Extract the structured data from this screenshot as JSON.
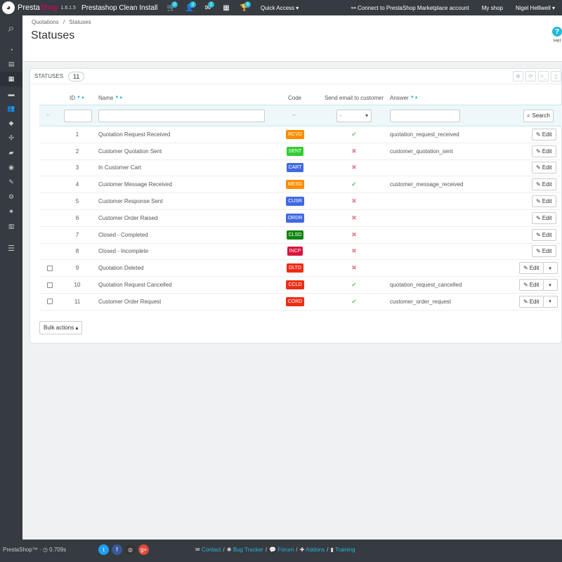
{
  "topbar": {
    "logo_presta": "Presta",
    "logo_shop": "Shop",
    "version": "1.6.1.5",
    "shop_name": "Prestashop Clean Install",
    "notifications": [
      {
        "icon": "cart-icon",
        "glyph": "🛒",
        "count": "0"
      },
      {
        "icon": "user-icon",
        "glyph": "👤",
        "count": "2"
      },
      {
        "icon": "envelope-icon",
        "glyph": "✉",
        "count": "2"
      },
      {
        "icon": "calculator-icon",
        "glyph": "▦",
        "count": ""
      },
      {
        "icon": "trophy-icon",
        "glyph": "🏆",
        "count": "8"
      }
    ],
    "quick_access": "Quick Access ▾",
    "marketplace": "Connect to PrestaShop Marketplace account",
    "my_shop": "My shop",
    "user": "Nigel Helliwell ▾"
  },
  "sidebar": {
    "items": [
      {
        "name": "dashboard-icon",
        "glyph": "◔"
      },
      {
        "name": "catalog-icon",
        "glyph": "▤"
      },
      {
        "name": "quotations-icon",
        "glyph": "▦"
      },
      {
        "name": "payment-icon",
        "glyph": "▬"
      },
      {
        "name": "customers-icon",
        "glyph": "👥"
      },
      {
        "name": "price-rules-icon",
        "glyph": "◆"
      },
      {
        "name": "modules-icon",
        "glyph": "✣"
      },
      {
        "name": "shipping-icon",
        "glyph": "▰"
      },
      {
        "name": "localization-icon",
        "glyph": "◉"
      },
      {
        "name": "preferences-icon",
        "glyph": "✎"
      },
      {
        "name": "advanced-parameters-icon",
        "glyph": "⚙"
      },
      {
        "name": "administration-icon",
        "glyph": "✷"
      },
      {
        "name": "stats-icon",
        "glyph": "▥"
      }
    ]
  },
  "breadcrumb": {
    "parent": "Quotations",
    "separator": "/",
    "current": "Statuses"
  },
  "page": {
    "title": "Statuses",
    "help": "Hel"
  },
  "panel": {
    "title": "Statuses",
    "count": "11",
    "bulk_actions": "Bulk actions ▴"
  },
  "columns": {
    "id": "ID",
    "name": "Name",
    "code": "Code",
    "send_email": "Send email to customer",
    "answer": "Answer",
    "sort_glyph": "▼▲"
  },
  "filters": {
    "code_placeholder": "--",
    "email_select": "-",
    "search_label": "Search",
    "reset_glyph": "--"
  },
  "rows": [
    {
      "id": "1",
      "name": "Quotation Request Received",
      "code": "RCVD",
      "color": "#ff8c00",
      "email": true,
      "answer": "quotation_request_received",
      "checkbox": false,
      "dropdown": false
    },
    {
      "id": "2",
      "name": "Customer Quotation Sent",
      "code": "SENT",
      "color": "#32cd32",
      "email": false,
      "answer": "customer_quotation_sent",
      "checkbox": false,
      "dropdown": false
    },
    {
      "id": "3",
      "name": "In Customer Cart",
      "code": "CART",
      "color": "#4169e1",
      "email": false,
      "answer": "",
      "checkbox": false,
      "dropdown": false
    },
    {
      "id": "4",
      "name": "Customer Message Received",
      "code": "MESG",
      "color": "#ff8c00",
      "email": true,
      "answer": "customer_message_received",
      "checkbox": false,
      "dropdown": false
    },
    {
      "id": "5",
      "name": "Customer Response Sent",
      "code": "CUSR",
      "color": "#4169e1",
      "email": false,
      "answer": "",
      "checkbox": false,
      "dropdown": false
    },
    {
      "id": "6",
      "name": "Customer Order Raised",
      "code": "ORDR",
      "color": "#4169e1",
      "email": false,
      "answer": "",
      "checkbox": false,
      "dropdown": false
    },
    {
      "id": "7",
      "name": "Closed - Completed",
      "code": "CLSD",
      "color": "#108510",
      "email": false,
      "answer": "",
      "checkbox": false,
      "dropdown": false
    },
    {
      "id": "8",
      "name": "Closed - Incomplete",
      "code": "INCP",
      "color": "#dc143c",
      "email": false,
      "answer": "",
      "checkbox": false,
      "dropdown": false
    },
    {
      "id": "9",
      "name": "Quotation Deleted",
      "code": "DLTD",
      "color": "#ec2e15",
      "email": false,
      "answer": "",
      "checkbox": true,
      "dropdown": true
    },
    {
      "id": "10",
      "name": "Quotation Request Cancelled",
      "code": "CCLD",
      "color": "#ec2e15",
      "email": true,
      "answer": "quotation_request_cancelled",
      "checkbox": true,
      "dropdown": true
    },
    {
      "id": "11",
      "name": "Customer Order Request",
      "code": "CORD",
      "color": "#ec2e15",
      "email": true,
      "answer": "customer_order_request",
      "checkbox": true,
      "dropdown": true
    }
  ],
  "row_labels": {
    "edit": "Edit",
    "check": "✔",
    "cross": "✖",
    "caret": "▾"
  },
  "footer": {
    "brand": "PrestaShop™",
    "separator": "·",
    "time": "0.709s",
    "links": [
      {
        "icon": "envelope-icon",
        "glyph": "✉",
        "label": "Contact"
      },
      {
        "icon": "bug-icon",
        "glyph": "✱",
        "label": "Bug Tracker"
      },
      {
        "icon": "forum-icon",
        "glyph": "💬",
        "label": "Forum"
      },
      {
        "icon": "puzzle-icon",
        "glyph": "✚",
        "label": "Addons"
      },
      {
        "icon": "book-icon",
        "glyph": "▮",
        "label": "Training"
      }
    ],
    "link_separator": "/",
    "social": [
      {
        "name": "twitter-icon",
        "glyph": "t",
        "color": "#1da1f2"
      },
      {
        "name": "facebook-icon",
        "glyph": "f",
        "color": "#3b5998"
      },
      {
        "name": "github-icon",
        "glyph": "◎",
        "color": "#333333"
      },
      {
        "name": "google-plus-icon",
        "glyph": "g+",
        "color": "#dd4b39"
      }
    ]
  }
}
